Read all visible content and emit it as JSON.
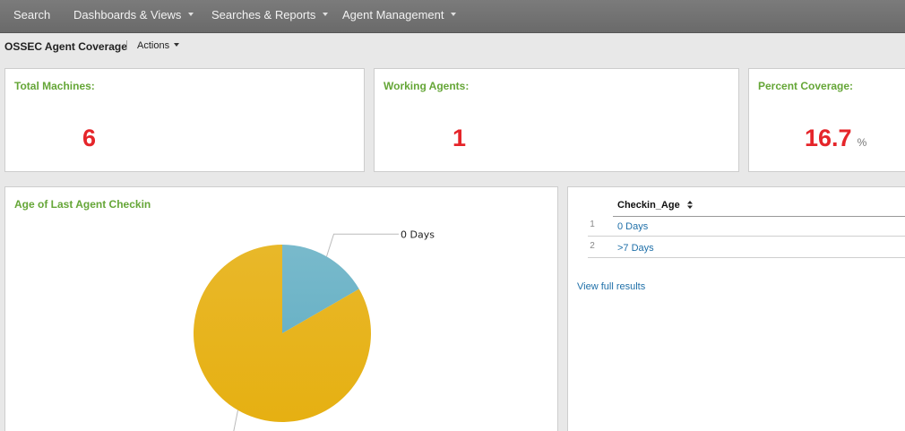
{
  "nav": {
    "items": [
      {
        "label": "Search"
      },
      {
        "label": "Dashboards & Views"
      },
      {
        "label": "Searches & Reports"
      },
      {
        "label": "Agent Management"
      }
    ]
  },
  "header": {
    "title": "OSSEC Agent Coverage",
    "separator": "|",
    "actions_label": "Actions"
  },
  "stats": {
    "total": {
      "title": "Total Machines:",
      "value": "6"
    },
    "working": {
      "title": "Working Agents:",
      "value": "1"
    },
    "coverage": {
      "title": "Percent Coverage:",
      "value": "16.7",
      "unit": "%"
    }
  },
  "chart_panel": {
    "title": "Age of Last Agent Checkin"
  },
  "chart_data": {
    "type": "pie",
    "categories": [
      "0 Days",
      ">7 Days"
    ],
    "values": [
      1,
      5
    ],
    "colors": [
      "#6ab2c6",
      "#e6b012"
    ]
  },
  "table": {
    "column": "Checkin_Age",
    "rows": [
      {
        "num": "1",
        "value": "0 Days"
      },
      {
        "num": "2",
        "value": ">7 Days"
      }
    ],
    "view_full": "View full results"
  }
}
